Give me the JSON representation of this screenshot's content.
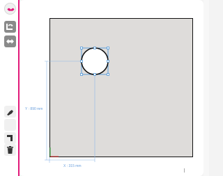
{
  "toolbar": {
    "tools": [
      "logo",
      "rotate",
      "swap",
      "pen",
      "blank",
      "corner",
      "trash"
    ]
  },
  "canvas": {
    "shape": "circle",
    "y_dimension": "Y : 890 mm",
    "x_dimension": "X : 315 mm"
  },
  "colors": {
    "accent": "#e2197a",
    "selection": "#3f8fd8",
    "plate": "#dedcda"
  },
  "icons": [
    "logo-icon",
    "rotate-icon",
    "swap-icon",
    "pen-icon",
    "corner-cut-icon",
    "trash-icon",
    "origin-axes-icon"
  ]
}
